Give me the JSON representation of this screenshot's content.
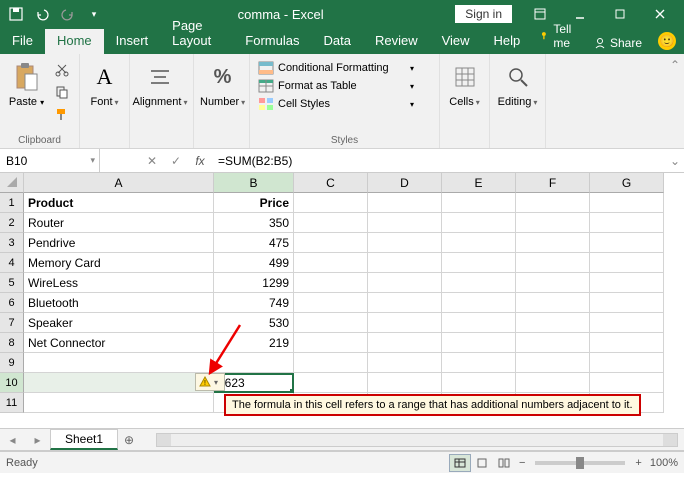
{
  "title": "comma - Excel",
  "signin": "Sign in",
  "tabs": [
    "File",
    "Home",
    "Insert",
    "Page Layout",
    "Formulas",
    "Data",
    "Review",
    "View",
    "Help"
  ],
  "tellme": "Tell me",
  "share": "Share",
  "ribbon": {
    "clipboard": {
      "paste": "Paste",
      "label": "Clipboard"
    },
    "font": {
      "btn": "Font",
      "label": "Font"
    },
    "alignment": {
      "btn": "Alignment"
    },
    "number": {
      "btn": "Number"
    },
    "styles": {
      "cond": "Conditional Formatting",
      "table": "Format as Table",
      "cell": "Cell Styles",
      "label": "Styles"
    },
    "cells": {
      "btn": "Cells"
    },
    "editing": {
      "btn": "Editing"
    }
  },
  "namebox": "B10",
  "formula": "=SUM(B2:B5)",
  "cols": [
    "A",
    "B",
    "C",
    "D",
    "E",
    "F",
    "G"
  ],
  "rows": [
    1,
    2,
    3,
    4,
    5,
    6,
    7,
    8,
    9,
    10,
    11
  ],
  "header": {
    "A": "Product",
    "B": "Price"
  },
  "data": [
    {
      "A": "Router",
      "B": "350"
    },
    {
      "A": "Pendrive",
      "B": "475"
    },
    {
      "A": "Memory Card",
      "B": "499"
    },
    {
      "A": "WireLess",
      "B": "1299"
    },
    {
      "A": "Bluetooth",
      "B": "749"
    },
    {
      "A": "Speaker",
      "B": "530"
    },
    {
      "A": "Net Connector",
      "B": "219"
    }
  ],
  "sumcell": "2623",
  "tooltip": "The formula in this cell refers to a range that has additional numbers adjacent to it.",
  "sheet": "Sheet1",
  "status": "Ready",
  "zoom": "100%",
  "plus": "+",
  "minus": "−"
}
